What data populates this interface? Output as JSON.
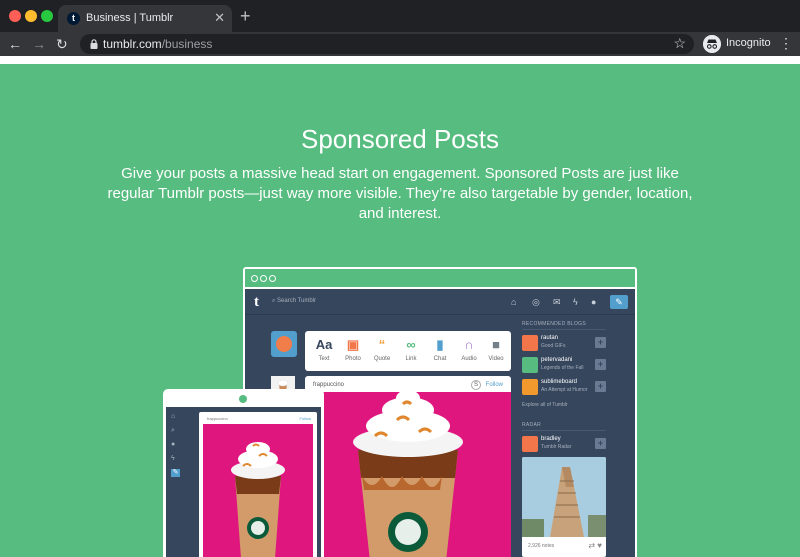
{
  "browser": {
    "tab_title": "Business | Tumblr",
    "favicon_letter": "t",
    "url_host": "tumblr.com",
    "url_path": "/business",
    "profile_label": "Incognito"
  },
  "hero": {
    "title": "Sponsored Posts",
    "subtitle": "Give your posts a massive head start on engagement. Sponsored Posts are just like regular Tumblr posts—just way more visible. They’re also targetable by gender, location, and interest."
  },
  "mockup": {
    "search_placeholder": "Search Tumblr",
    "post_types": [
      {
        "label": "Text",
        "icon": "Aa",
        "color": "#36465d"
      },
      {
        "label": "Photo",
        "icon": "▣",
        "color": "#f2764a"
      },
      {
        "label": "Quote",
        "icon": "“",
        "color": "#f2992e"
      },
      {
        "label": "Link",
        "icon": "∞",
        "color": "#56bc7f"
      },
      {
        "label": "Chat",
        "icon": "▮",
        "color": "#529ecc"
      },
      {
        "label": "Audio",
        "icon": "∩",
        "color": "#a77dc2"
      },
      {
        "label": "Video",
        "icon": "■",
        "color": "#748089"
      }
    ],
    "post": {
      "username": "frappuccino",
      "follow_label": "Follow",
      "badge": "S"
    },
    "recommended": {
      "heading": "Recommended Blogs",
      "blogs": [
        {
          "name": "rautan",
          "sub": "Good GIFs",
          "color": "#f2764a"
        },
        {
          "name": "petervadani",
          "sub": "Legends of the Fall",
          "color": "#56bc7f"
        },
        {
          "name": "sublimeboard",
          "sub": "An Attempt at Humor",
          "color": "#f2992e"
        }
      ],
      "explore": "Explore all of Tumblr"
    },
    "radar": {
      "heading": "Radar",
      "name": "bradley",
      "sub": "Tumblr Radar",
      "notes": "2,926 notes",
      "color": "#f2764a"
    },
    "tablet": {
      "username": "frappuccino",
      "follow_label": "Follow"
    }
  }
}
